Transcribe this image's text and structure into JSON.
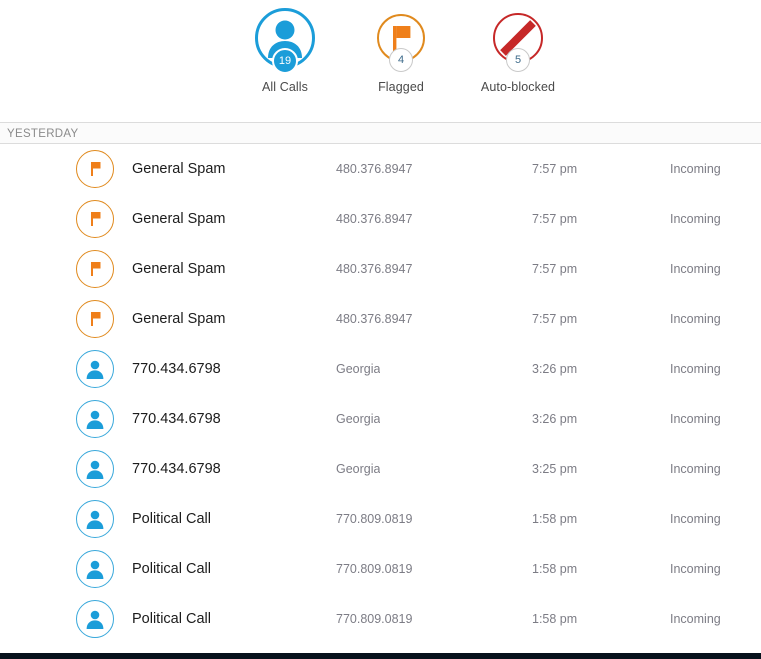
{
  "summary": {
    "tabs": [
      {
        "id": "all-calls",
        "label": "All Calls",
        "count": "19",
        "icon": "person-icon",
        "accent": "#1b9dd9",
        "badge_style": "filled"
      },
      {
        "id": "flagged",
        "label": "Flagged",
        "count": "4",
        "icon": "flag-icon",
        "accent": "#e08a1e",
        "badge_style": "hollow"
      },
      {
        "id": "auto-blocked",
        "label": "Auto-blocked",
        "count": "5",
        "icon": "prohibition-icon",
        "accent": "#c62828",
        "badge_style": "hollow"
      }
    ]
  },
  "sections": [
    {
      "header": "YESTERDAY",
      "rows": [
        {
          "icon": "flag-icon",
          "name": "General Spam",
          "sub": "480.376.8947",
          "time": "7:57 pm",
          "direction": "Incoming"
        },
        {
          "icon": "flag-icon",
          "name": "General Spam",
          "sub": "480.376.8947",
          "time": "7:57 pm",
          "direction": "Incoming"
        },
        {
          "icon": "flag-icon",
          "name": "General Spam",
          "sub": "480.376.8947",
          "time": "7:57 pm",
          "direction": "Incoming"
        },
        {
          "icon": "flag-icon",
          "name": "General Spam",
          "sub": "480.376.8947",
          "time": "7:57 pm",
          "direction": "Incoming"
        },
        {
          "icon": "person-icon",
          "name": "770.434.6798",
          "sub": "Georgia",
          "time": "3:26 pm",
          "direction": "Incoming"
        },
        {
          "icon": "person-icon",
          "name": "770.434.6798",
          "sub": "Georgia",
          "time": "3:26 pm",
          "direction": "Incoming"
        },
        {
          "icon": "person-icon",
          "name": "770.434.6798",
          "sub": "Georgia",
          "time": "3:25 pm",
          "direction": "Incoming"
        },
        {
          "icon": "person-icon",
          "name": "Political Call",
          "sub": "770.809.0819",
          "time": "1:58 pm",
          "direction": "Incoming"
        },
        {
          "icon": "person-icon",
          "name": "Political Call",
          "sub": "770.809.0819",
          "time": "1:58 pm",
          "direction": "Incoming"
        },
        {
          "icon": "person-icon",
          "name": "Political Call",
          "sub": "770.809.0819",
          "time": "1:58 pm",
          "direction": "Incoming"
        }
      ]
    }
  ],
  "colors": {
    "blue": "#1b9dd9",
    "orange": "#e08a1e",
    "red": "#c62828",
    "row_text": "#1c1c1c",
    "muted_text": "#7c7c85",
    "section_text": "#8b8b8b"
  }
}
